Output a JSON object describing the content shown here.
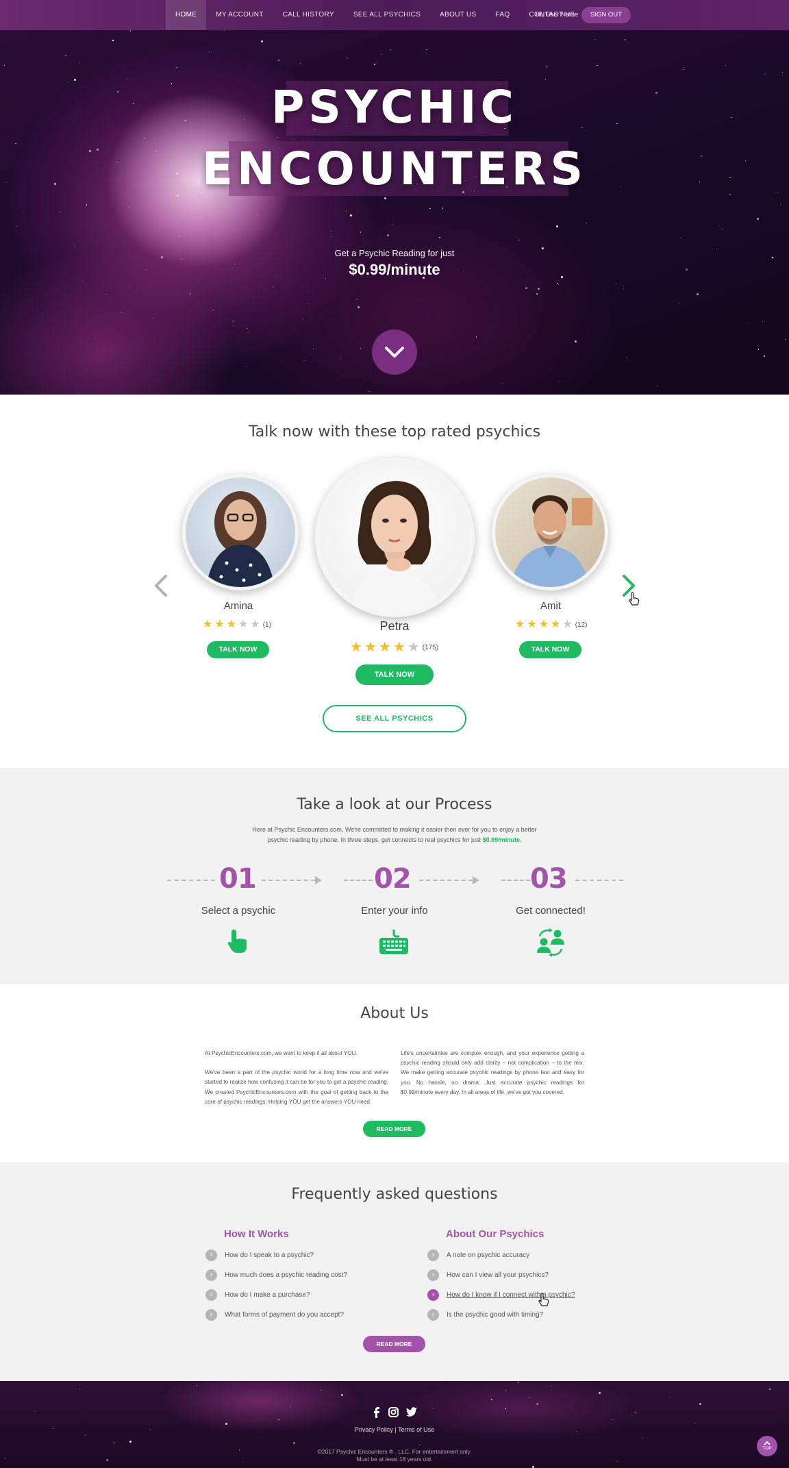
{
  "nav": {
    "links": [
      "HOME",
      "MY ACCOUNT",
      "CALL HISTORY",
      "SEE ALL PSYCHICS",
      "ABOUT US",
      "FAQ",
      "CONTACT US"
    ],
    "active": "HOME",
    "greeting": "Hi, User Name",
    "signout": "SIGN OUT"
  },
  "hero": {
    "title_line1": "PSYCHIC",
    "title_line2": "ENCOUNTERS",
    "subtitle": "Get a Psychic Reading for just",
    "price": "$0.99/minute"
  },
  "psychics": {
    "heading": "Talk now with these top rated psychics",
    "items": [
      {
        "name": "Amina",
        "rating": 3,
        "count": "(1)",
        "button": "TALK NOW"
      },
      {
        "name": "Petra",
        "rating": 4,
        "count": "(175)",
        "button": "TALK NOW"
      },
      {
        "name": "Amit",
        "rating": 4,
        "count": "(12)",
        "button": "TALK NOW"
      }
    ],
    "see_all": "SEE ALL PSYCHICS"
  },
  "process": {
    "heading": "Take a look at our Process",
    "desc_line1": "Here at Psychic Encounters.com, We're committed to making it easier then ever for you to enjoy a better",
    "desc_line2": "psychic reading by phone. In three steps, get connects to real psychics for just",
    "desc_price": "$0.99/minute.",
    "steps": [
      {
        "num": "01",
        "label": "Select a psychic",
        "icon": "pointing-hand-icon"
      },
      {
        "num": "02",
        "label": "Enter your info",
        "icon": "keyboard-icon"
      },
      {
        "num": "03",
        "label": "Get connected!",
        "icon": "people-connect-icon"
      }
    ]
  },
  "about": {
    "heading": "About Us",
    "left_p1": "At PsychicEncounters.com, we want to keep it all about YOU.",
    "left_p2": "We've been a part of the psychic world for a long time now and we've started to realize how confusing it can be for you to get a psychic reading. We created PsychicEncounters.com with the goal of getting back to the core of psychic readings: Helping YOU get the answers YOU need.",
    "right_p1": "Life's uncertainties are complex enough, and your experience getting a psychic reading should only add clarity – not complication – to the mix. We make getting accurate psychic readings by phone fast and easy for you. No hassle, no drama. Just accurate psychic readings for $0.99/minute every day. In all areas of life, we've got you covered.",
    "button": "READ MORE"
  },
  "faq": {
    "heading": "Frequently asked questions",
    "col1_title": "How It Works",
    "col1": [
      "How do I speak to a psychic?",
      "How much does a psychic reading cost?",
      "How do I make a purchase?",
      "What forms of payment do you accept?"
    ],
    "col2_title": "About Our Psychics",
    "col2": [
      "A note on psychic accuracy",
      "How can I view all your psychics?",
      "How do I know if I connect with a psychic?",
      "Is the psychic good with timing?"
    ],
    "button": "READ MORE"
  },
  "footer": {
    "privacy": "Privacy Policy",
    "sep": "|",
    "terms": "Terms of Use",
    "copyright1": "©2017  Psychic Encounters ® , LLC. For entertainment only.",
    "copyright2": "Must be at least 18 years old.",
    "top": "TOP",
    "social": [
      "facebook-icon",
      "instagram-icon",
      "twitter-icon"
    ]
  },
  "colors": {
    "purple": "#a253a9",
    "green": "#1fbb63",
    "nav": "#5c2466"
  }
}
